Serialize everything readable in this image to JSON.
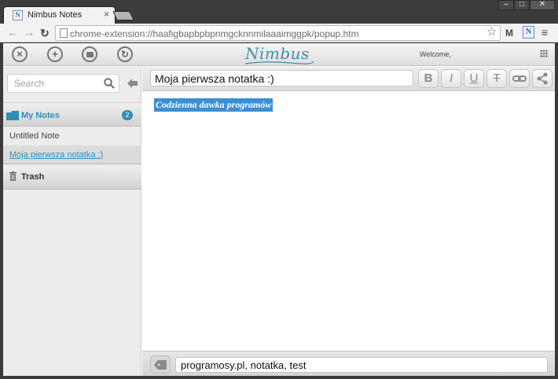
{
  "browser": {
    "tab_title": "Nimbus Notes",
    "tab_close": "×",
    "url": "chrome-extension://haafigbapbpbpnmgcknnmilaaaimggpk/popup.htm",
    "window_controls": [
      "–",
      "□",
      "✕"
    ],
    "gmail_label": "M"
  },
  "app": {
    "logo": "Nimbus",
    "welcome": "Welcome,",
    "header_buttons": [
      "close-icon",
      "add-icon",
      "folder-icon",
      "sync-icon"
    ]
  },
  "sidebar": {
    "search_placeholder": "Search",
    "notebook": {
      "title": "My Notes",
      "count": "2"
    },
    "notes": [
      {
        "title": "Untitled Note"
      },
      {
        "title": "Moja pierwsza notatka :)"
      }
    ],
    "trash_label": "Trash"
  },
  "editor": {
    "title_value": "Moja pierwsza notatka :)",
    "format_buttons": [
      {
        "label": "B",
        "icon": "bold-icon"
      },
      {
        "label": "I",
        "icon": "italic-icon"
      },
      {
        "label": "U",
        "icon": "underline-icon"
      },
      {
        "label": "T",
        "icon": "strikethrough-icon"
      }
    ],
    "body_text": "Codzienna dawka programów",
    "tags_value": "programosy.pl, notatka, test"
  },
  "colors": {
    "accent": "#2e8eb8",
    "selection": "#3a8fd9"
  }
}
